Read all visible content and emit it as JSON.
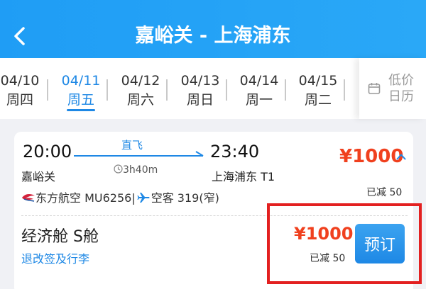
{
  "header": {
    "title": "嘉峪关 - 上海浦东",
    "back_icon": "chevron-left-icon"
  },
  "date_bar": {
    "dates": [
      {
        "date": "04/10",
        "weekday": "周四",
        "active": false
      },
      {
        "date": "04/11",
        "weekday": "周五",
        "active": true
      },
      {
        "date": "04/12",
        "weekday": "周六",
        "active": false
      },
      {
        "date": "04/13",
        "weekday": "周日",
        "active": false
      },
      {
        "date": "04/14",
        "weekday": "周一",
        "active": false
      },
      {
        "date": "04/15",
        "weekday": "周二",
        "active": false
      }
    ],
    "calendar_label": "低价日历",
    "calendar_icon": "calendar-icon"
  },
  "flight": {
    "dep_time": "20:00",
    "arr_time": "23:40",
    "dep_city": "嘉峪关",
    "arr_city": "上海浦东 T1",
    "direct_label": "直飞",
    "duration": "3h40m",
    "price": "¥1000",
    "discount": "已减 50",
    "airline": "东方航空 MU6256|",
    "aircraft": "空客 319(窄)"
  },
  "cabin": {
    "name": "经济舱 S舱",
    "policy_link": "退改签及行李",
    "price": "¥1000",
    "discount": "已减 50",
    "book_label": "预订"
  },
  "colors": {
    "brand_blue": "#1e88e5",
    "price_red": "#f0401e",
    "highlight_red": "#e32020"
  }
}
